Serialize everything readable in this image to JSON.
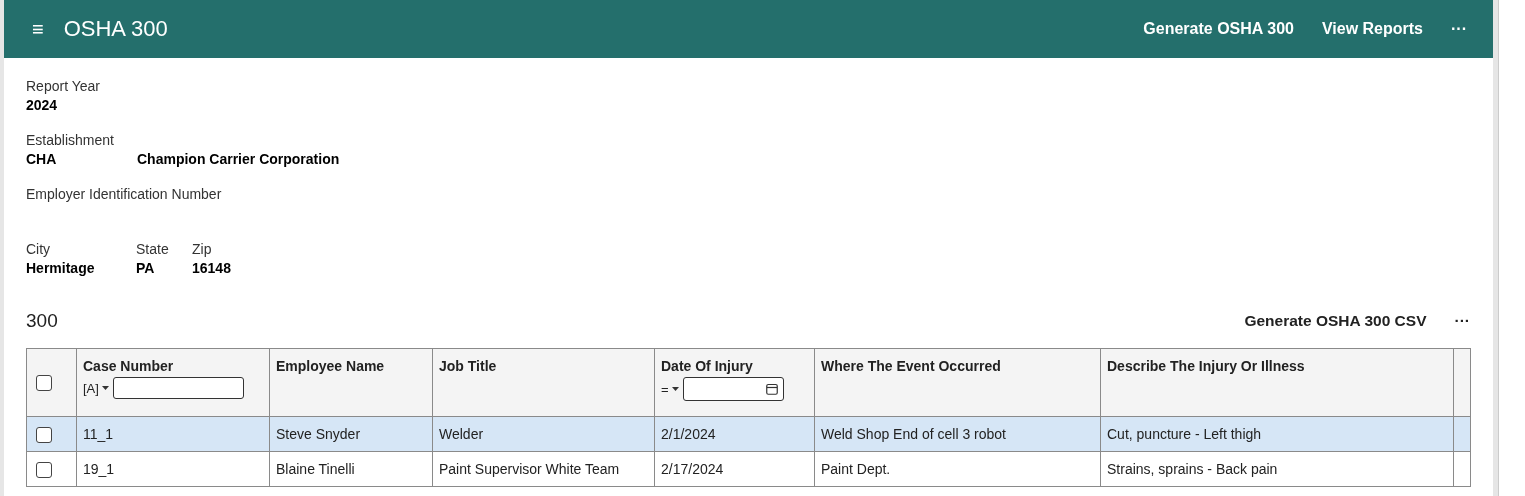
{
  "header": {
    "menu_icon": "≡",
    "title": "OSHA 300",
    "actions": [
      "Generate OSHA 300",
      "View Reports"
    ],
    "more": "···"
  },
  "report": {
    "year_label": "Report Year",
    "year": "2024",
    "establishment_label": "Establishment",
    "establishment_code": "CHA",
    "establishment_name": "Champion Carrier Corporation",
    "ein_label": "Employer Identification Number",
    "address": [
      {
        "label": "City",
        "value": "Hermitage"
      },
      {
        "label": "State",
        "value": "PA"
      },
      {
        "label": "Zip",
        "value": "16148"
      }
    ]
  },
  "table_section": {
    "title": "300",
    "action": "Generate OSHA 300 CSV",
    "more": "···",
    "all_checked": false,
    "filters": {
      "case_number": {
        "operator": "[A]"
      },
      "date_of_injury": {
        "operator": "="
      }
    },
    "columns": [
      "Case Number",
      "Employee Name",
      "Job Title",
      "Date Of Injury",
      "Where The Event Occurred",
      "Describe The Injury Or Illness"
    ],
    "rows": [
      {
        "selected": true,
        "checked": false,
        "cells": [
          "11_1",
          "Steve Snyder",
          "Welder",
          "2/1/2024",
          "Weld Shop End of cell 3 robot",
          "Cut, puncture - Left thigh"
        ]
      },
      {
        "selected": false,
        "checked": false,
        "cells": [
          "19_1",
          "Blaine Tinelli",
          "Paint Supervisor White Team",
          "2/17/2024",
          "Paint Dept.",
          "Strains, sprains - Back pain"
        ]
      }
    ]
  }
}
